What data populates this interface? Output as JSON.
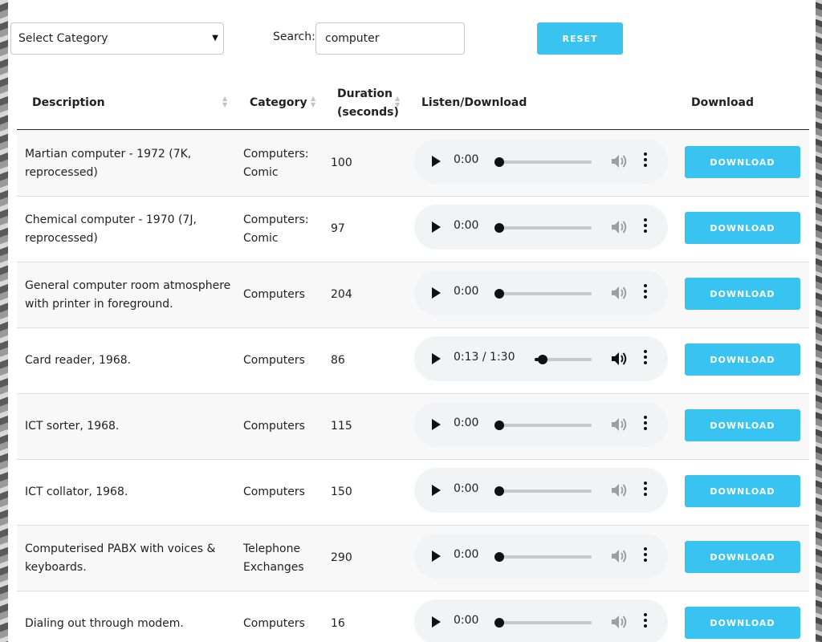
{
  "filters": {
    "category_select": "Select Category",
    "search_label": "Search:",
    "search_value": "computer",
    "reset_label": "RESET"
  },
  "table": {
    "headers": {
      "description": "Description",
      "category": "Category",
      "duration_line1": "Duration",
      "duration_line2": "(seconds)",
      "listen": "Listen/Download",
      "download": "Download"
    },
    "rows": [
      {
        "description": "Martian computer - 1972 (7K, reprocessed)",
        "category": "Computers: Comic",
        "duration": "100",
        "player_time": "0:00",
        "progress": 0,
        "muted": true
      },
      {
        "description": "Chemical computer - 1970 (7J, reprocessed)",
        "category": "Computers: Comic",
        "duration": "97",
        "player_time": "0:00",
        "progress": 0,
        "muted": true
      },
      {
        "description": "General computer room atmosphere with printer in foreground.",
        "category": "Computers",
        "duration": "204",
        "player_time": "0:00",
        "progress": 0,
        "muted": true
      },
      {
        "description": "Card reader, 1968.",
        "category": "Computers",
        "duration": "86",
        "player_time": "0:13 / 1:30",
        "progress": 0.144,
        "muted": false
      },
      {
        "description": "ICT sorter, 1968.",
        "category": "Computers",
        "duration": "115",
        "player_time": "0:00",
        "progress": 0,
        "muted": true
      },
      {
        "description": "ICT collator, 1968.",
        "category": "Computers",
        "duration": "150",
        "player_time": "0:00",
        "progress": 0,
        "muted": true
      },
      {
        "description": "Computerised PABX with voices & keyboards.",
        "category": "Telephone Exchanges",
        "duration": "290",
        "player_time": "0:00",
        "progress": 0,
        "muted": true
      },
      {
        "description": "Dialing out through modem.",
        "category": "Computers",
        "duration": "16",
        "player_time": "0:00",
        "progress": 0,
        "muted": true
      }
    ],
    "download_label": "DOWNLOAD"
  },
  "colors": {
    "accent": "#38c3f0",
    "player_bg": "#f1f3f4"
  },
  "icons": {
    "play": "play-icon",
    "volume": "volume-icon",
    "more": "more-vertical-icon",
    "sort": "sort-icon",
    "caret": "chevron-down-icon"
  }
}
